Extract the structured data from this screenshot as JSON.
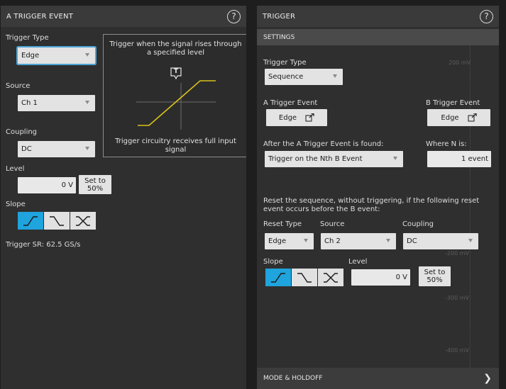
{
  "left_panel": {
    "title": "A TRIGGER EVENT",
    "help_icon": "help-icon",
    "trigger_type": {
      "label": "Trigger Type",
      "value": "Edge"
    },
    "source": {
      "label": "Source",
      "value": "Ch 1"
    },
    "coupling": {
      "label": "Coupling",
      "value": "DC"
    },
    "level": {
      "label": "Level",
      "value": "0 V",
      "set_button": "Set to 50%"
    },
    "slope": {
      "label": "Slope",
      "options": [
        "rising-edge-icon",
        "falling-edge-icon",
        "either-edge-icon"
      ],
      "selected": "rising"
    },
    "trigger_sr": "Trigger SR: 62.5 GS/s",
    "diagram": {
      "top_text": "Trigger when the signal rises through a specified level",
      "marker": "T",
      "bottom_text": "Trigger circuitry receives full input signal",
      "signal_color": "#d9c21a"
    }
  },
  "right_panel": {
    "title": "TRIGGER",
    "help_icon": "help-icon",
    "settings_label": "SETTINGS",
    "trigger_type": {
      "label": "Trigger Type",
      "value": "Sequence"
    },
    "a_event": {
      "label": "A Trigger Event",
      "value": "Edge"
    },
    "b_event": {
      "label": "B Trigger Event",
      "value": "Edge"
    },
    "after_a": {
      "label": "After the A Trigger Event is found:",
      "value": "Trigger on the Nth B Event"
    },
    "where_n": {
      "label": "Where N is:",
      "value": "1 event"
    },
    "reset_text": "Reset the sequence, without triggering, if the following reset event occurs before the B event:",
    "reset_type": {
      "label": "Reset Type",
      "value": "Edge"
    },
    "reset_source": {
      "label": "Source",
      "value": "Ch 2"
    },
    "reset_coupling": {
      "label": "Coupling",
      "value": "DC"
    },
    "slope": {
      "label": "Slope",
      "options": [
        "rising-edge-icon",
        "falling-edge-icon",
        "either-edge-icon"
      ],
      "selected": "rising"
    },
    "level": {
      "label": "Level",
      "value": "0 V",
      "set_button": "Set to 50%"
    },
    "mode_holdoff": "MODE & HOLDOFF",
    "background_scale": [
      "200 mV",
      "-200 mV",
      "-300 mV",
      "-400 mV"
    ]
  },
  "colors": {
    "accent": "#1fa4dd",
    "panel": "#2f2f2f",
    "header": "#3a3a3a"
  }
}
